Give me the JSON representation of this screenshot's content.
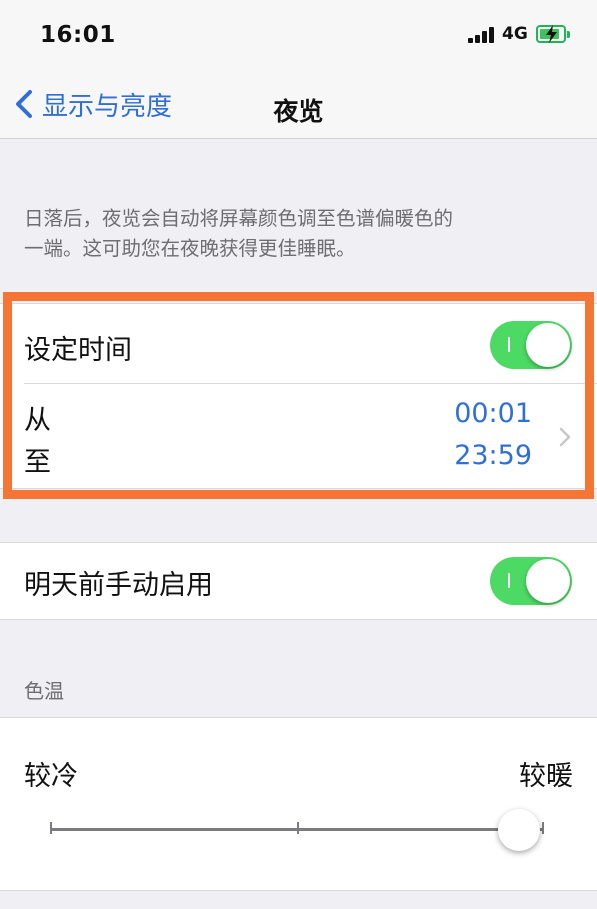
{
  "status_bar": {
    "time": "16:01",
    "network": "4G",
    "battery_level": 0.85,
    "battery_color": "#3dc25c"
  },
  "nav": {
    "back_label": "显示与亮度",
    "title": "夜览",
    "accent_color": "#2f6fd6"
  },
  "description": {
    "line1": "日落后，夜览会自动将屏幕颜色调至色谱偏暖色的",
    "line2": "一端。这可助您在夜晚获得更佳睡眠。"
  },
  "schedule": {
    "label": "设定时间",
    "toggle_on": true,
    "from_label": "从",
    "to_label": "至",
    "from_time": "00:01",
    "to_time": "23:59"
  },
  "manual": {
    "label": "明天前手动启用",
    "toggle_on": true
  },
  "color_temperature": {
    "header": "色温",
    "less_warm_label": "较冷",
    "more_warm_label": "较暖",
    "value": 0.95
  },
  "highlight_color": "#f57535",
  "toggle_color": "#4cd964"
}
